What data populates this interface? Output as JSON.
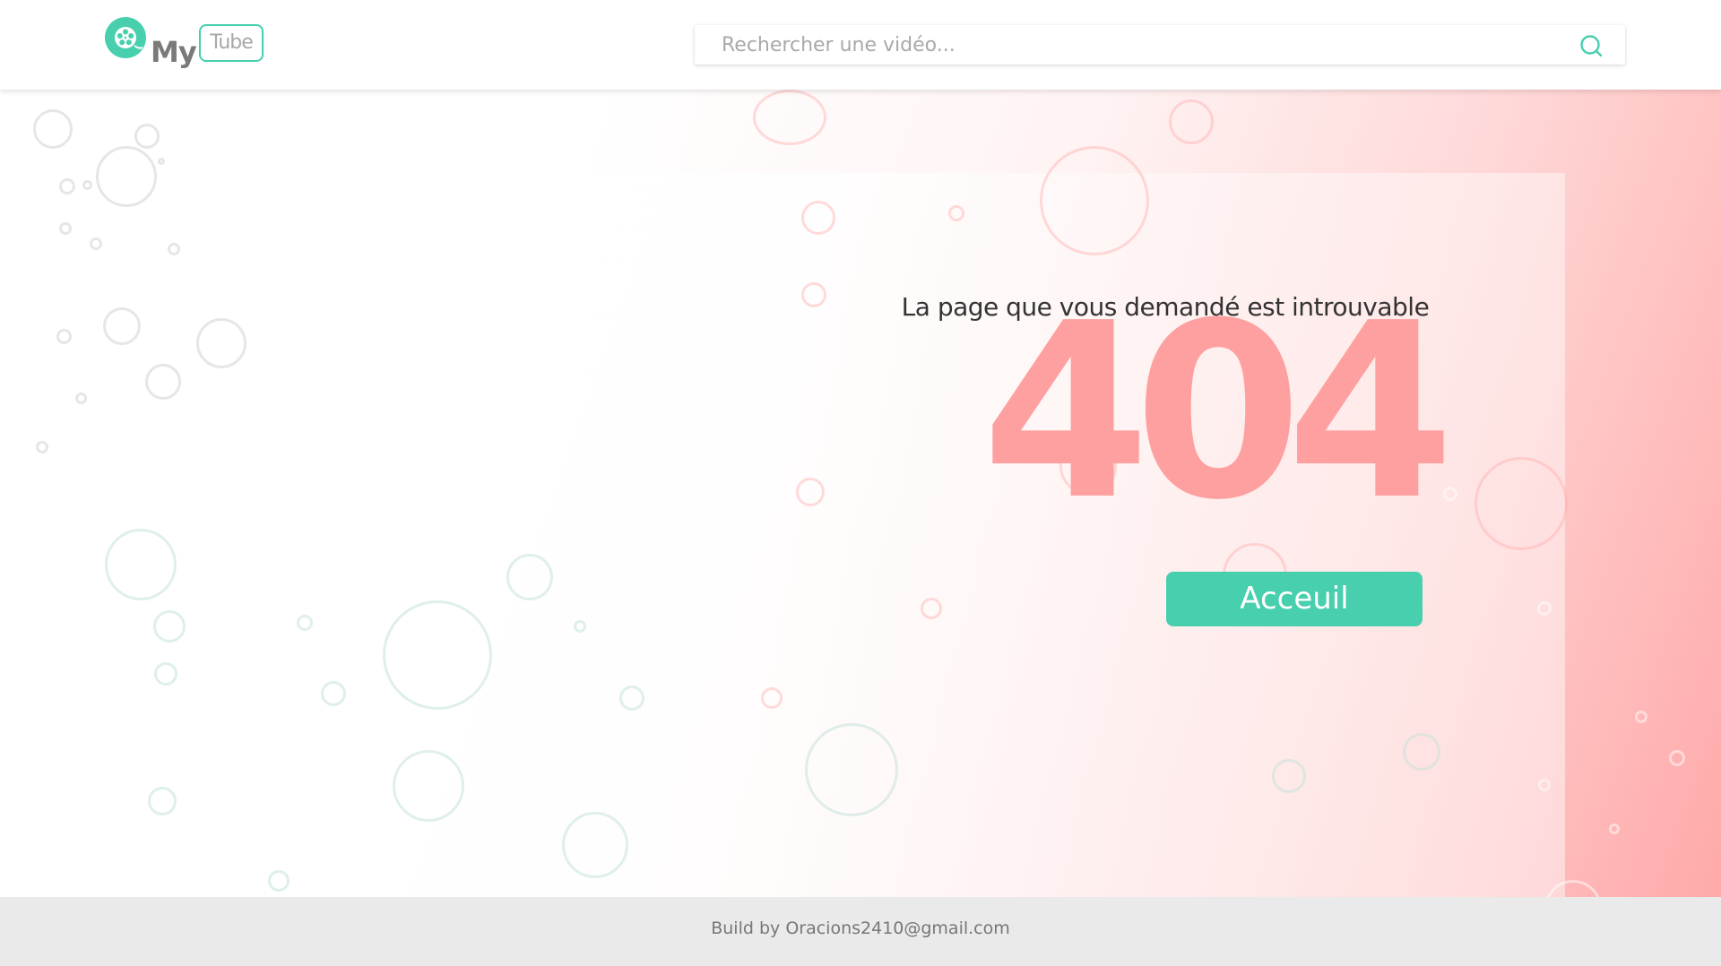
{
  "header": {
    "logo": {
      "my": "My",
      "tube": "Tube"
    },
    "search": {
      "placeholder": "Rechercher une vidéo..."
    }
  },
  "main": {
    "message": "La page que vous demandé est introuvable",
    "code": "404",
    "home_button": "Acceuil"
  },
  "footer": {
    "credit": "Build by Oracions2410@gmail.com"
  },
  "colors": {
    "accent": "#48cfae",
    "error_code": "#ffa0a0",
    "footer_bg": "#eaeaea"
  },
  "icons": {
    "logo": "film-reel-icon",
    "search": "search-icon"
  }
}
